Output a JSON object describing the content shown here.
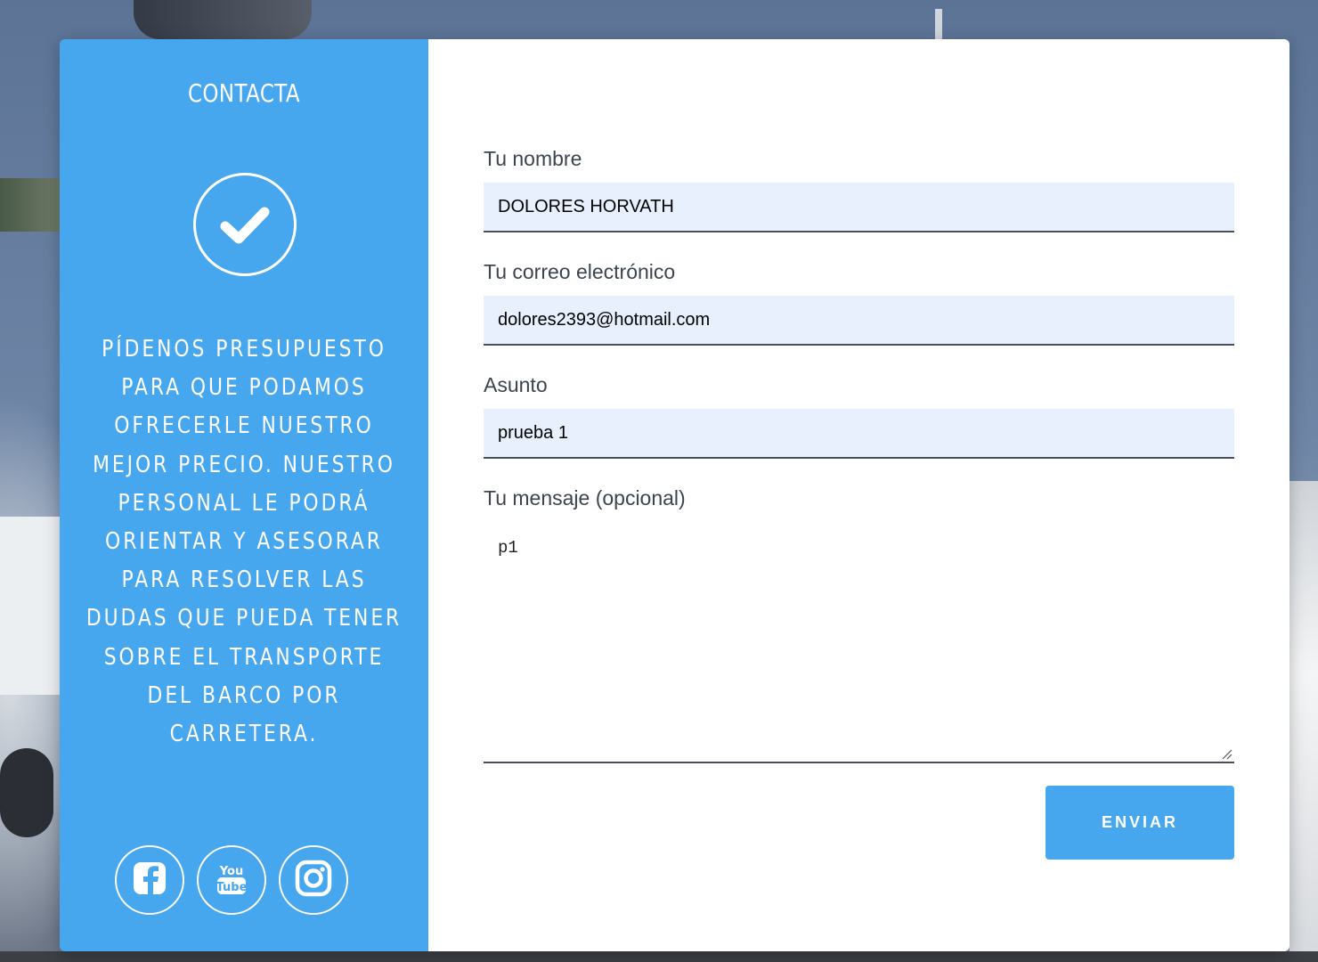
{
  "panel": {
    "title": "CONTACTA",
    "tagline": "PÍDENOS PRESUPUESTO PARA QUE PODAMOS OFRECERLE NUESTRO MEJOR PRECIO. NUESTRO PERSONAL LE PODRÁ ORIENTAR Y ASESORAR PARA RESOLVER LAS DUDAS QUE PUEDA TENER SOBRE EL TRANSPORTE DEL BARCO POR CARRETERA.",
    "icon": "check-circle-icon",
    "social": [
      {
        "icon": "facebook-icon"
      },
      {
        "icon": "youtube-icon",
        "text_top": "You",
        "text_bottom": "Tube"
      },
      {
        "icon": "instagram-icon"
      }
    ]
  },
  "form": {
    "name_label": "Tu nombre",
    "name_value": "DOLORES HORVATH",
    "email_label": "Tu correo electrónico",
    "email_value": "dolores2393@hotmail.com",
    "subject_label": "Asunto",
    "subject_value": "prueba 1",
    "message_label": "Tu mensaje (opcional)",
    "message_value": "p1",
    "submit_label": "ENVIAR"
  },
  "colors": {
    "accent": "#47a7ee",
    "autofill": "#e8f0fe",
    "label": "#3d4450"
  }
}
